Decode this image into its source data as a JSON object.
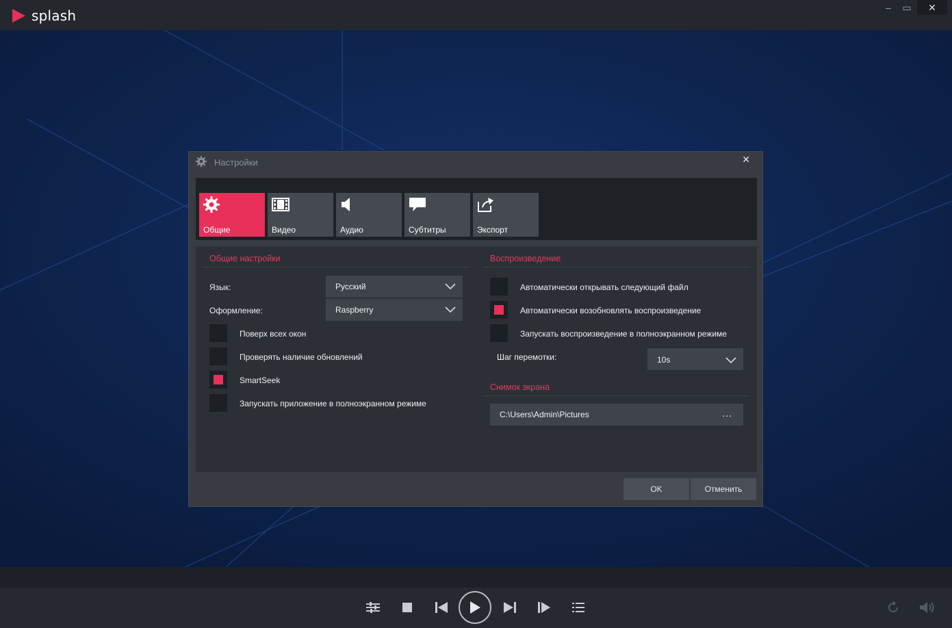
{
  "app": {
    "name": "splash"
  },
  "window_controls": {
    "minimize": "–",
    "maximize": "▭",
    "close": "✕"
  },
  "dialog": {
    "title": "Настройки",
    "close": "✕",
    "tabs": [
      {
        "label": "Общие",
        "icon": "gear-icon",
        "active": true
      },
      {
        "label": "Видео",
        "icon": "film-icon",
        "active": false
      },
      {
        "label": "Аудио",
        "icon": "speaker-icon",
        "active": false
      },
      {
        "label": "Субтитры",
        "icon": "speech-bubble-icon",
        "active": false
      },
      {
        "label": "Экспорт",
        "icon": "export-icon",
        "active": false
      }
    ],
    "general": {
      "title": "Общие настройки",
      "language_label": "Язык:",
      "language_value": "Русский",
      "theme_label": "Оформление:",
      "theme_value": "Raspberry",
      "checks": [
        {
          "label": "Поверх всех окон",
          "checked": false
        },
        {
          "label": "Проверять наличие обновлений",
          "checked": false
        },
        {
          "label": "SmartSeek",
          "checked": true
        },
        {
          "label": "Запускать приложение в полноэкранном режиме",
          "checked": false
        }
      ]
    },
    "playback": {
      "title": "Воспроизведение",
      "checks": [
        {
          "label": "Автоматически открывать следующий файл",
          "checked": false
        },
        {
          "label": "Автоматически возобновлять воспроизведение",
          "checked": true
        },
        {
          "label": "Запускать воспроизведение в полноэкранном режиме",
          "checked": false
        }
      ],
      "seek_label": "Шаг перемотки:",
      "seek_value": "10s"
    },
    "screenshot": {
      "title": "Снимок экрана",
      "path": "C:\\Users\\Admin\\Pictures",
      "browse": "..."
    },
    "ok": "OK",
    "cancel": "Отменить"
  },
  "colors": {
    "accent": "#e8305a",
    "background": "#0e2147",
    "dialog": "#383c42"
  }
}
